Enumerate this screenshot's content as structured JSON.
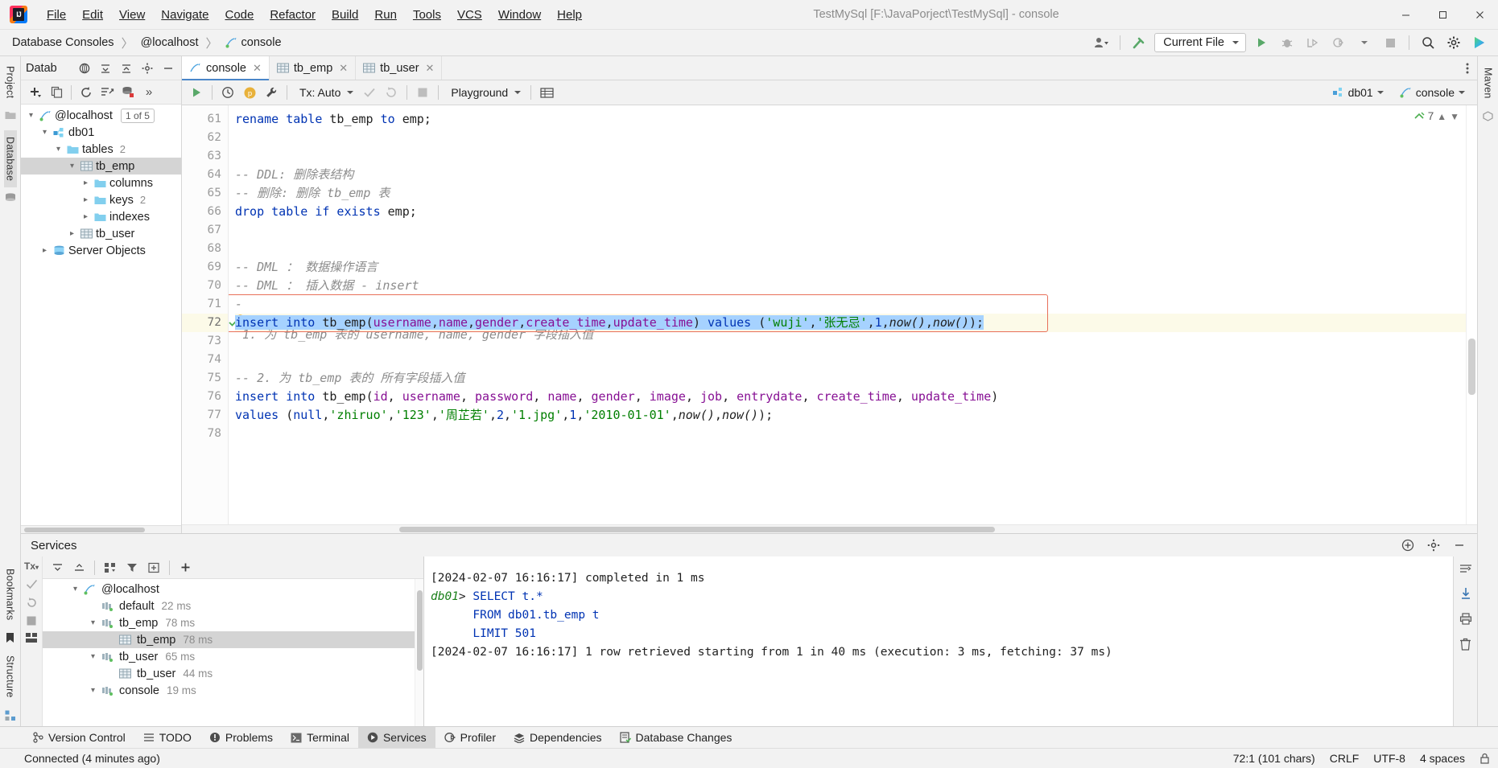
{
  "titlebar": {
    "app_icon": "intellij-logo",
    "menu": [
      "File",
      "Edit",
      "View",
      "Navigate",
      "Code",
      "Refactor",
      "Build",
      "Run",
      "Tools",
      "VCS",
      "Window",
      "Help"
    ],
    "window_title": "TestMySql [F:\\JavaPorject\\TestMySql] - console",
    "minimize": "—",
    "maximize": "☐",
    "close": "✕"
  },
  "navbar": {
    "breadcrumbs": [
      "Database Consoles",
      "@localhost",
      "console"
    ],
    "separator": "〉",
    "run_config": "Current File",
    "icons": [
      "user-avatar-icon",
      "hammer-icon",
      "run-icon",
      "debug-icon",
      "run-with-coverage-icon",
      "profile-icon",
      "stop-icon",
      "search-everywhere-icon",
      "settings-icon",
      "ide-helper-icon"
    ]
  },
  "left_rail": {
    "tabs": [
      "Project",
      "Database"
    ],
    "bottom_icons": [
      "structure-icon",
      "bookmarks-icon"
    ]
  },
  "right_rail": {
    "tabs": [
      "Maven"
    ]
  },
  "database_panel": {
    "title": "Datab",
    "header_icons": [
      "data-sources-icon",
      "collapse-all-icon",
      "expand-all-icon",
      "settings-icon",
      "hide-icon"
    ],
    "toolbar_icons": [
      "add-icon",
      "copy-icon",
      "refresh-icon",
      "jump-to-query-icon",
      "sync-icon",
      "more-icon"
    ],
    "tree": [
      {
        "label": "@localhost",
        "icon": "connection-icon",
        "arrow": "⌄",
        "indent": 0,
        "badge": "1 of 5",
        "selected": false
      },
      {
        "label": "db01",
        "icon": "schema-icon",
        "arrow": "⌄",
        "indent": 1,
        "selected": false
      },
      {
        "label": "tables",
        "icon": "folder-icon",
        "arrow": "⌄",
        "indent": 2,
        "count": "2",
        "selected": false
      },
      {
        "label": "tb_emp",
        "icon": "table-icon",
        "arrow": "⌄",
        "indent": 3,
        "selected": true
      },
      {
        "label": "columns",
        "icon": "folder-icon",
        "arrow": "›",
        "indent": 4,
        "selected": false
      },
      {
        "label": "keys",
        "icon": "folder-icon",
        "arrow": "›",
        "indent": 4,
        "count": "2",
        "selected": false
      },
      {
        "label": "indexes",
        "icon": "folder-icon",
        "arrow": "›",
        "indent": 4,
        "selected": false
      },
      {
        "label": "tb_user",
        "icon": "table-icon",
        "arrow": "›",
        "indent": 3,
        "selected": false
      },
      {
        "label": "Server Objects",
        "icon": "server-objects-icon",
        "arrow": "›",
        "indent": 1,
        "selected": false
      }
    ]
  },
  "editor": {
    "tabs": [
      {
        "label": "console",
        "icon": "console-icon",
        "active": true,
        "close": "✕"
      },
      {
        "label": "tb_emp",
        "icon": "table-icon",
        "active": false,
        "close": "✕"
      },
      {
        "label": "tb_user",
        "icon": "table-icon",
        "active": false,
        "close": "✕"
      }
    ],
    "toolbar": {
      "run_icon": "run-icon",
      "history_icon": "history-icon",
      "explain_icon": "explain-plan-icon",
      "wrench_icon": "settings-wrench-icon",
      "tx_label": "Tx: Auto",
      "commit_icon": "commit-icon",
      "rollback_icon": "rollback-icon",
      "stop_icon": "stop-icon",
      "schema_label": "Playground",
      "grid_icon": "data-editor-icon",
      "datasource_label": "db01",
      "session_label": "console"
    },
    "inspection_count": "7",
    "status_position": "72:1 (101 chars)",
    "first_line_number": 61,
    "lines": [
      {
        "n": 61,
        "tokens": [
          {
            "t": "rename table ",
            "c": "kw"
          },
          {
            "t": "tb_emp ",
            "c": "pl"
          },
          {
            "t": "to ",
            "c": "kw"
          },
          {
            "t": "emp;",
            "c": "pl"
          }
        ]
      },
      {
        "n": 62,
        "tokens": []
      },
      {
        "n": 63,
        "tokens": []
      },
      {
        "n": 64,
        "tokens": [
          {
            "t": "-- DDL: 删除表结构",
            "c": "cm"
          }
        ]
      },
      {
        "n": 65,
        "tokens": [
          {
            "t": "-- 删除: 删除 tb_emp 表",
            "c": "cm"
          }
        ]
      },
      {
        "n": 66,
        "tokens": [
          {
            "t": "drop table if exists ",
            "c": "kw"
          },
          {
            "t": "emp;",
            "c": "pl"
          }
        ]
      },
      {
        "n": 67,
        "tokens": []
      },
      {
        "n": 68,
        "tokens": []
      },
      {
        "n": 69,
        "tokens": [
          {
            "t": "-- DML ： 数据操作语言",
            "c": "cm"
          }
        ]
      },
      {
        "n": 70,
        "tokens": [
          {
            "t": "-- DML ： 插入数据 - insert",
            "c": "cm"
          }
        ]
      },
      {
        "n": 71,
        "tokens": [
          {
            "t": "-- 1. 为 tb_emp 表的 username, name, gender 字段插入值",
            "c": "cm"
          }
        ]
      },
      {
        "n": 72,
        "selected": true,
        "tokens": [
          {
            "t": "insert into ",
            "c": "kw"
          },
          {
            "t": "tb_emp",
            "c": "pl"
          },
          {
            "t": "(",
            "c": "pl"
          },
          {
            "t": "username",
            "c": "col"
          },
          {
            "t": ",",
            "c": "pl"
          },
          {
            "t": "name",
            "c": "col"
          },
          {
            "t": ",",
            "c": "pl"
          },
          {
            "t": "gender",
            "c": "col"
          },
          {
            "t": ",",
            "c": "pl"
          },
          {
            "t": "create_time",
            "c": "col"
          },
          {
            "t": ",",
            "c": "pl"
          },
          {
            "t": "update_time",
            "c": "col"
          },
          {
            "t": ") ",
            "c": "pl"
          },
          {
            "t": "values ",
            "c": "kw"
          },
          {
            "t": "(",
            "c": "pl"
          },
          {
            "t": "'wuji'",
            "c": "str"
          },
          {
            "t": ",",
            "c": "pl"
          },
          {
            "t": "'张无忌'",
            "c": "str"
          },
          {
            "t": ",",
            "c": "pl"
          },
          {
            "t": "1",
            "c": "num"
          },
          {
            "t": ",",
            "c": "pl"
          },
          {
            "t": "now()",
            "c": "fn"
          },
          {
            "t": ",",
            "c": "pl"
          },
          {
            "t": "now()",
            "c": "fn"
          },
          {
            "t": ");",
            "c": "pl"
          }
        ]
      },
      {
        "n": 73,
        "tokens": []
      },
      {
        "n": 74,
        "tokens": []
      },
      {
        "n": 75,
        "tokens": [
          {
            "t": "-- 2. 为 tb_emp 表的 所有字段插入值",
            "c": "cm"
          }
        ]
      },
      {
        "n": 76,
        "tokens": [
          {
            "t": "insert into ",
            "c": "kw"
          },
          {
            "t": "tb_emp",
            "c": "pl"
          },
          {
            "t": "(",
            "c": "pl"
          },
          {
            "t": "id",
            "c": "col"
          },
          {
            "t": ", ",
            "c": "pl"
          },
          {
            "t": "username",
            "c": "col"
          },
          {
            "t": ", ",
            "c": "pl"
          },
          {
            "t": "password",
            "c": "col"
          },
          {
            "t": ", ",
            "c": "pl"
          },
          {
            "t": "name",
            "c": "col"
          },
          {
            "t": ", ",
            "c": "pl"
          },
          {
            "t": "gender",
            "c": "col"
          },
          {
            "t": ", ",
            "c": "pl"
          },
          {
            "t": "image",
            "c": "col"
          },
          {
            "t": ", ",
            "c": "pl"
          },
          {
            "t": "job",
            "c": "col"
          },
          {
            "t": ", ",
            "c": "pl"
          },
          {
            "t": "entrydate",
            "c": "col"
          },
          {
            "t": ", ",
            "c": "pl"
          },
          {
            "t": "create_time",
            "c": "col"
          },
          {
            "t": ", ",
            "c": "pl"
          },
          {
            "t": "update_time",
            "c": "col"
          },
          {
            "t": ")",
            "c": "pl"
          }
        ]
      },
      {
        "n": 77,
        "tokens": [
          {
            "t": "values ",
            "c": "kw"
          },
          {
            "t": "(",
            "c": "pl"
          },
          {
            "t": "null",
            "c": "kw"
          },
          {
            "t": ",",
            "c": "pl"
          },
          {
            "t": "'zhiruo'",
            "c": "str"
          },
          {
            "t": ",",
            "c": "pl"
          },
          {
            "t": "'123'",
            "c": "str"
          },
          {
            "t": ",",
            "c": "pl"
          },
          {
            "t": "'周芷若'",
            "c": "str"
          },
          {
            "t": ",",
            "c": "pl"
          },
          {
            "t": "2",
            "c": "num"
          },
          {
            "t": ",",
            "c": "pl"
          },
          {
            "t": "'1.jpg'",
            "c": "str"
          },
          {
            "t": ",",
            "c": "pl"
          },
          {
            "t": "1",
            "c": "num"
          },
          {
            "t": ",",
            "c": "pl"
          },
          {
            "t": "'2010-01-01'",
            "c": "str"
          },
          {
            "t": ",",
            "c": "pl"
          },
          {
            "t": "now()",
            "c": "fn"
          },
          {
            "t": ",",
            "c": "pl"
          },
          {
            "t": "now()",
            "c": "fn"
          },
          {
            "t": ");",
            "c": "pl"
          }
        ]
      },
      {
        "n": 78,
        "tokens": []
      }
    ]
  },
  "services": {
    "title": "Services",
    "header_icons": [
      "add-service-icon",
      "settings-icon",
      "hide-icon"
    ],
    "rail_icons": [
      "tx-icon",
      "commit-icon",
      "rollback-icon",
      "stop-icon",
      "layout-icon"
    ],
    "toolbar_icons": [
      "collapse-all-icon",
      "expand-all-icon",
      "group-icon",
      "filter-icon",
      "add-tab-icon",
      "plus-icon"
    ],
    "tree": [
      {
        "label": "@localhost",
        "icon": "connection-icon",
        "arrow": "⌄",
        "indent": 0,
        "selected": false
      },
      {
        "label": "default",
        "time": "22 ms",
        "icon": "session-icon",
        "arrow": "",
        "indent": 1,
        "selected": false
      },
      {
        "label": "tb_emp",
        "time": "78 ms",
        "icon": "session-icon",
        "arrow": "⌄",
        "indent": 1,
        "selected": false
      },
      {
        "label": "tb_emp",
        "time": "78 ms",
        "icon": "table-icon",
        "arrow": "",
        "indent": 2,
        "selected": true
      },
      {
        "label": "tb_user",
        "time": "65 ms",
        "icon": "session-icon",
        "arrow": "⌄",
        "indent": 1,
        "selected": false
      },
      {
        "label": "tb_user",
        "time": "44 ms",
        "icon": "table-icon",
        "arrow": "",
        "indent": 2,
        "selected": false
      },
      {
        "label": "console",
        "time": "19 ms",
        "icon": "session-icon",
        "arrow": "⌄",
        "indent": 1,
        "selected": false
      }
    ],
    "console_output": [
      {
        "parts": [
          {
            "t": "[2024-02-07 16:16:17] completed in 1 ms",
            "c": "plain"
          }
        ]
      },
      {
        "parts": [
          {
            "t": "db01",
            "c": "prompt"
          },
          {
            "t": "> ",
            "c": "plain"
          },
          {
            "t": "SELECT",
            "c": "kw"
          },
          {
            "t": " t.*",
            "c": "kw"
          }
        ]
      },
      {
        "parts": [
          {
            "t": "      ",
            "c": "plain"
          },
          {
            "t": "FROM",
            "c": "kw"
          },
          {
            "t": " db01.tb_emp t",
            "c": "kw"
          }
        ]
      },
      {
        "parts": [
          {
            "t": "      ",
            "c": "plain"
          },
          {
            "t": "LIMIT",
            "c": "kw"
          },
          {
            "t": " 501",
            "c": "kw"
          }
        ]
      },
      {
        "parts": [
          {
            "t": "[2024-02-07 16:16:17] 1 row retrieved starting from 1 in 40 ms (execution: 3 ms, fetching: 37 ms)",
            "c": "plain"
          }
        ]
      }
    ],
    "console_side_icons": [
      "wrap-text-icon",
      "scroll-to-end-icon",
      "print-icon",
      "delete-icon"
    ]
  },
  "toolwindow_bar": {
    "tabs": [
      {
        "label": "Version Control",
        "icon": "vcs-icon",
        "active": false
      },
      {
        "label": "TODO",
        "icon": "todo-icon",
        "active": false
      },
      {
        "label": "Problems",
        "icon": "problems-icon",
        "active": false
      },
      {
        "label": "Terminal",
        "icon": "terminal-icon",
        "active": false
      },
      {
        "label": "Services",
        "icon": "services-icon",
        "active": true
      },
      {
        "label": "Profiler",
        "icon": "profiler-icon",
        "active": false
      },
      {
        "label": "Dependencies",
        "icon": "dependencies-icon",
        "active": false
      },
      {
        "label": "Database Changes",
        "icon": "database-changes-icon",
        "active": false
      }
    ]
  },
  "statusbar": {
    "message": "Connected (4 minutes ago)",
    "caret": "72:1 (101 chars)",
    "line_separator": "CRLF",
    "encoding": "UTF-8",
    "indent": "4 spaces",
    "read_only_icon": "lock-icon"
  },
  "colors": {
    "accent_blue": "#4a86c8",
    "selection": "#a6d2ff",
    "current_line": "#fcfae8",
    "error_box": "#e8705a",
    "green_run": "#4caf50",
    "tree_selected": "#d4d4d4"
  }
}
